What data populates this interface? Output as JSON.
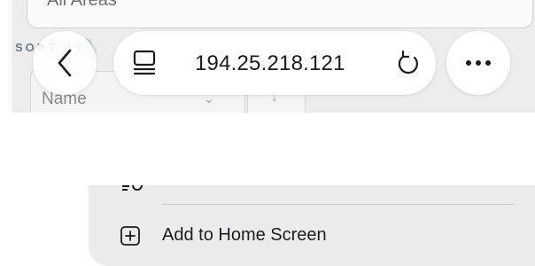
{
  "background_page": {
    "search_text": "All Areas",
    "sort_label": "SORT BY",
    "sort_select_value": "Name",
    "sort_direction": "↓"
  },
  "browser": {
    "url": "194.25.218.121",
    "back_icon": "chevron-left-icon",
    "tabs_icon": "page-menu-icon",
    "reload_icon": "reload-icon",
    "more_icon": "more-horizontal-icon"
  },
  "menu": {
    "items": [
      {
        "label": "Add to Home Screen",
        "icon": "add-square-icon"
      }
    ]
  },
  "colors": {
    "chrome_bg": "#ededee",
    "sheet_bg": "#ececee",
    "text": "#1c1c1e"
  }
}
